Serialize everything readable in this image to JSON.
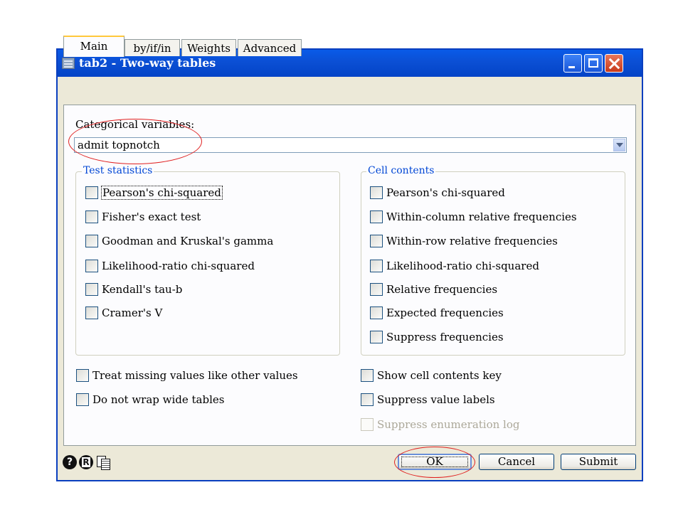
{
  "window": {
    "title": "tab2 - Two-way tables"
  },
  "tabs": [
    {
      "label": "Main",
      "active": true
    },
    {
      "label": "by/if/in",
      "active": false
    },
    {
      "label": "Weights",
      "active": false
    },
    {
      "label": "Advanced",
      "active": false
    }
  ],
  "categorical": {
    "label": "Categorical variables:",
    "value": "admit topnotch"
  },
  "test_statistics": {
    "title": "Test statistics",
    "items": [
      {
        "label": "Pearson's chi-squared",
        "checked": false,
        "focused": true
      },
      {
        "label": "Fisher's exact test",
        "checked": false
      },
      {
        "label": "Goodman and Kruskal's gamma",
        "checked": false
      },
      {
        "label": "Likelihood-ratio chi-squared",
        "checked": false
      },
      {
        "label": "Kendall's tau-b",
        "checked": false
      },
      {
        "label": "Cramer's V",
        "checked": false
      }
    ]
  },
  "cell_contents": {
    "title": "Cell contents",
    "items": [
      {
        "label": "Pearson's chi-squared",
        "checked": false
      },
      {
        "label": "Within-column relative frequencies",
        "checked": false
      },
      {
        "label": "Within-row relative frequencies",
        "checked": false
      },
      {
        "label": "Likelihood-ratio chi-squared",
        "checked": false
      },
      {
        "label": "Relative frequencies",
        "checked": false
      },
      {
        "label": "Expected frequencies",
        "checked": false
      },
      {
        "label": "Suppress frequencies",
        "checked": false
      }
    ]
  },
  "options_left": [
    {
      "label": "Treat missing values like other values",
      "checked": false
    },
    {
      "label": "Do not wrap wide tables",
      "checked": false
    }
  ],
  "options_right": [
    {
      "label": "Show cell contents key",
      "checked": false
    },
    {
      "label": "Suppress value labels",
      "checked": false
    },
    {
      "label": "Suppress enumeration log",
      "checked": false,
      "disabled": true
    }
  ],
  "buttons": {
    "ok": "OK",
    "cancel": "Cancel",
    "submit": "Submit"
  },
  "footer_icons": {
    "help": "?",
    "reset": "R",
    "copy": "copy-command-icon"
  },
  "colors": {
    "titlebar": "#0b4fd4",
    "group_title": "#0046d5",
    "annotation": "#e02020"
  }
}
